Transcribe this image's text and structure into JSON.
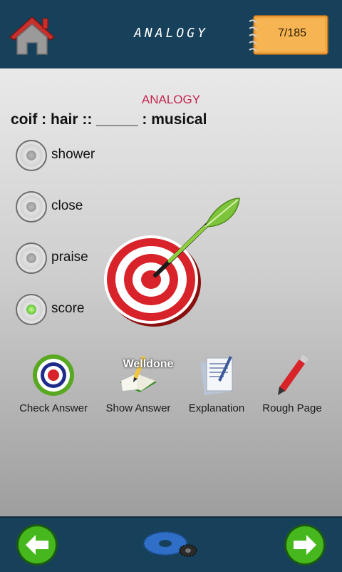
{
  "header": {
    "title": "ANALOGY",
    "counter": "7/185",
    "home_icon": "home-icon"
  },
  "quiz": {
    "subject": "ANALOGY",
    "question": "coif : hair :: _____ : musical",
    "options": [
      {
        "label": "shower",
        "selected": false
      },
      {
        "label": "close",
        "selected": false
      },
      {
        "label": "praise",
        "selected": false
      },
      {
        "label": "score",
        "selected": true
      }
    ],
    "feedback": "Welldone"
  },
  "tools": [
    {
      "label": "Check Answer",
      "icon": "target-icon"
    },
    {
      "label": "Show Answer",
      "icon": "book-pencil-icon"
    },
    {
      "label": "Explanation",
      "icon": "document-pen-icon"
    },
    {
      "label": "Rough Page",
      "icon": "pencil-icon"
    }
  ],
  "footer": {
    "back_icon": "arrow-left-icon",
    "next_icon": "arrow-right-icon",
    "settings_icon": "gear-icon"
  },
  "colors": {
    "bar": "#17405a",
    "subject": "#c4264f",
    "nav_green": "#46b81e",
    "pad": "#f2a640"
  }
}
